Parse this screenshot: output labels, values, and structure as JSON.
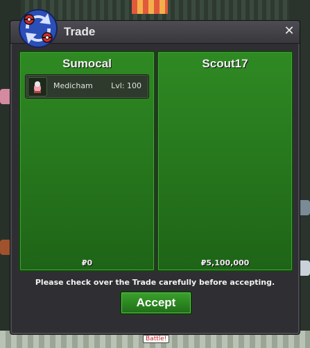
{
  "window": {
    "title": "Trade",
    "close_label": "✕"
  },
  "left_panel": {
    "player": "Sumocal",
    "items": [
      {
        "name": "Medicham",
        "level": "Lvl: 100"
      }
    ],
    "money": "₽0"
  },
  "right_panel": {
    "player": "Scout17",
    "items": [],
    "money": "₽5,100,000"
  },
  "notice": "Please check over the Trade carefully before accepting.",
  "accept_label": "Accept",
  "world": {
    "battle_tag": "Battle!"
  },
  "icons": [
    "trade-logo-icon",
    "close-icon",
    "pokemon-icon"
  ],
  "colors": {
    "panel_green": "#2f8a23",
    "window_bg": "#2f2f33",
    "accept_green": "#3aa12c"
  }
}
